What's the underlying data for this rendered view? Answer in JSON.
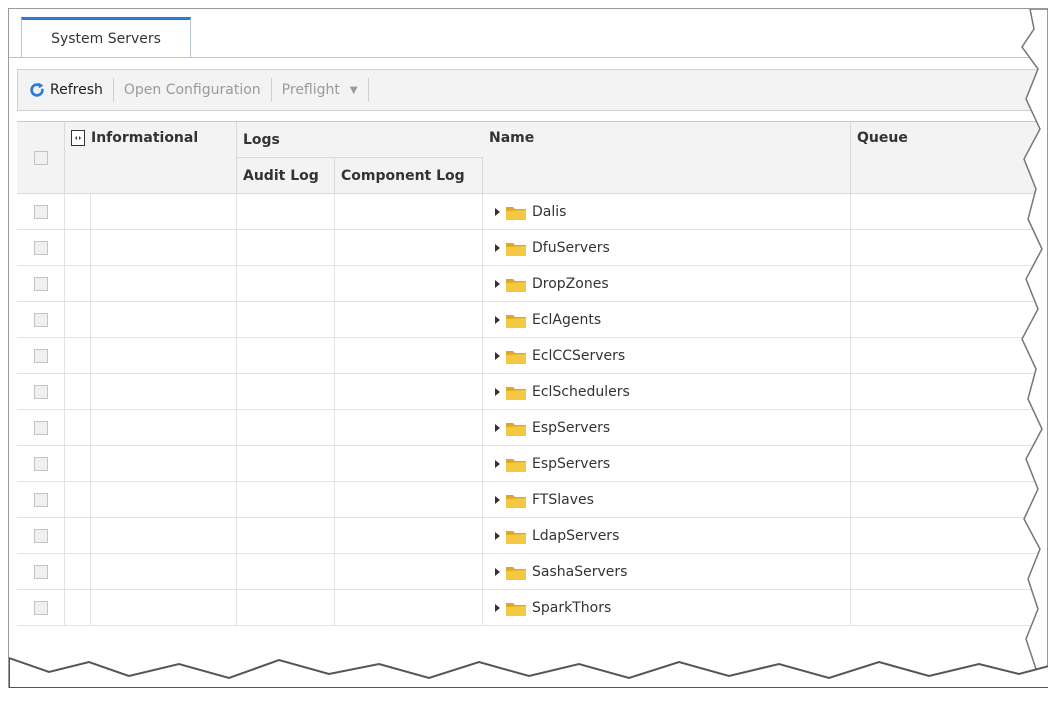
{
  "tabs": [
    {
      "label": "System Servers",
      "active": true
    }
  ],
  "toolbar": {
    "refresh_label": "Refresh",
    "open_config_label": "Open Configuration",
    "preflight_label": "Preflight",
    "preflight_caret": "▼"
  },
  "grid": {
    "columns": {
      "informational": "Informational",
      "logs": "Logs",
      "audit_log": "Audit Log",
      "component_log": "Component Log",
      "name": "Name",
      "queue": "Queue"
    },
    "rows": [
      {
        "name": "Dalis"
      },
      {
        "name": "DfuServers"
      },
      {
        "name": "DropZones"
      },
      {
        "name": "EclAgents"
      },
      {
        "name": "EclCCServers"
      },
      {
        "name": "EclSchedulers"
      },
      {
        "name": "EspServers"
      },
      {
        "name": "EspServers"
      },
      {
        "name": "FTSlaves"
      },
      {
        "name": "LdapServers"
      },
      {
        "name": "SashaServers"
      },
      {
        "name": "SparkThors"
      }
    ]
  },
  "colors": {
    "accent": "#2b7bd6",
    "folder": "#f5c842",
    "header_bg": "#f3f3f3"
  },
  "icons": [
    "refresh-icon",
    "info-icon",
    "folder-icon",
    "expander-arrow-icon"
  ]
}
